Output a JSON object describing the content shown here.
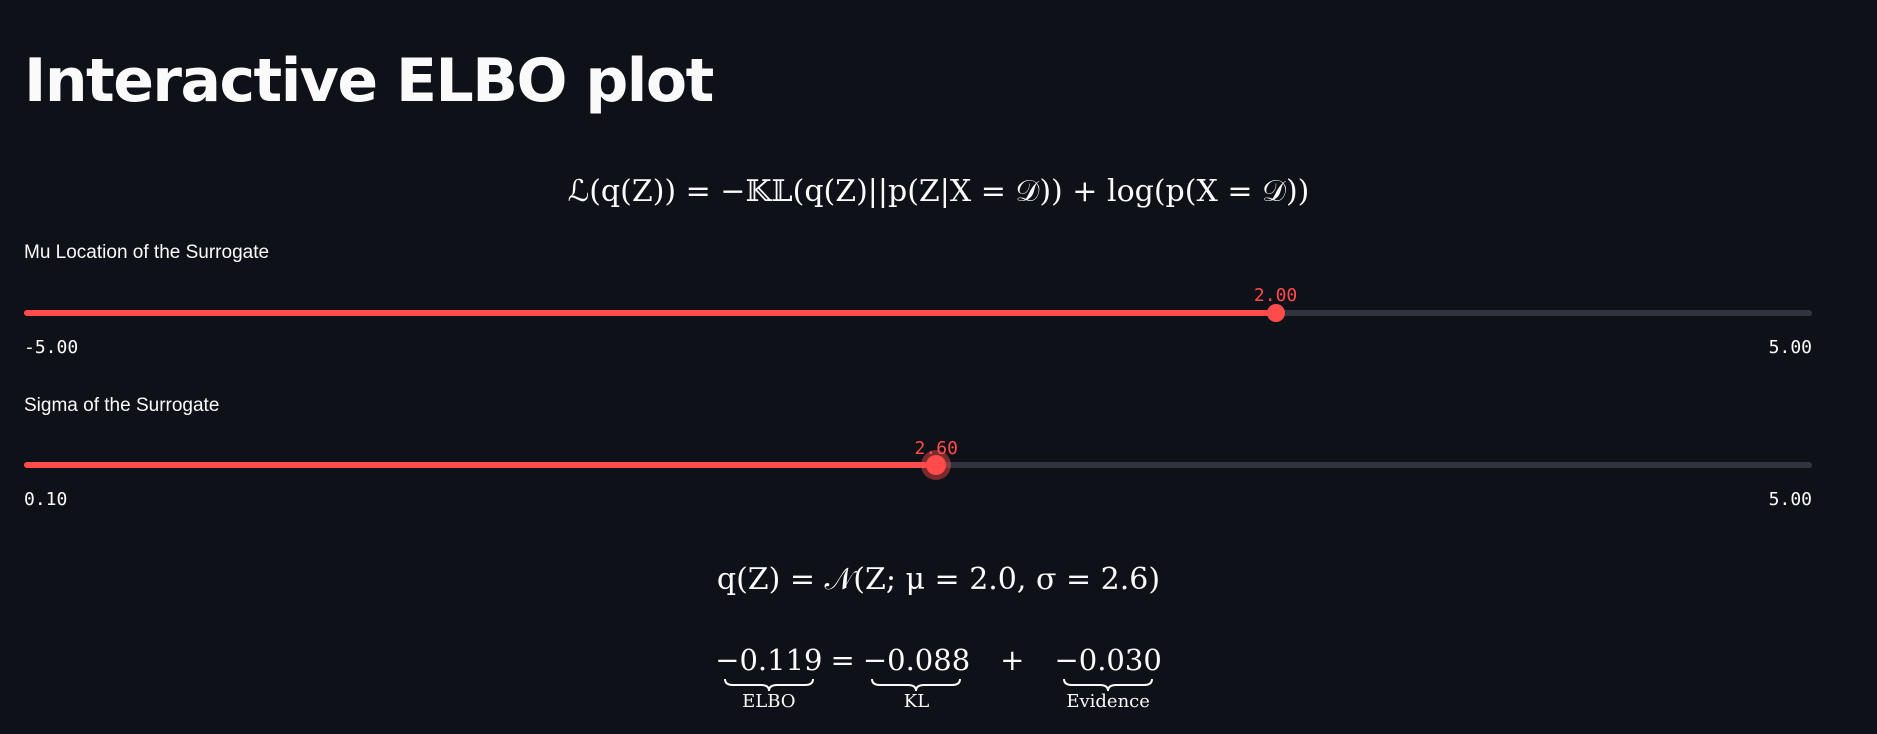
{
  "page": {
    "title": "Interactive ELBO plot"
  },
  "formulas": {
    "elbo_definition": "ℒ(q(Z)) = −𝕂𝕃(q(Z)||p(Z|X = 𝒟)) + log(p(X = 𝒟))",
    "surrogate_prefix": "q(Z) = 𝒩(Z; μ = ",
    "surrogate_sep": ", σ = ",
    "surrogate_suffix": ")"
  },
  "sliders": {
    "mu": {
      "label": "Mu Location of the Surrogate",
      "min_label": "-5.00",
      "max_label": "5.00",
      "min": -5.0,
      "max": 5.0,
      "value": 2.0,
      "value_label": "2.00",
      "focused": false
    },
    "sigma": {
      "label": "Sigma of the Surrogate",
      "min_label": "0.10",
      "max_label": "5.00",
      "min": 0.1,
      "max": 5.0,
      "value": 2.6,
      "value_label": "2.60",
      "focused": true
    }
  },
  "surrogate": {
    "mu": "2.0",
    "sigma": "2.6"
  },
  "decomposition": {
    "elbo_value": "−0.119",
    "elbo_label": "ELBO",
    "equals": "=",
    "kl_value": "−0.088",
    "kl_label": "KL",
    "plus": "+",
    "evidence_value": "−0.030",
    "evidence_label": "Evidence"
  },
  "colors": {
    "background": "#0e1117",
    "accent": "#ff4b4b",
    "track": "#31333f",
    "text": "#fafafa"
  }
}
